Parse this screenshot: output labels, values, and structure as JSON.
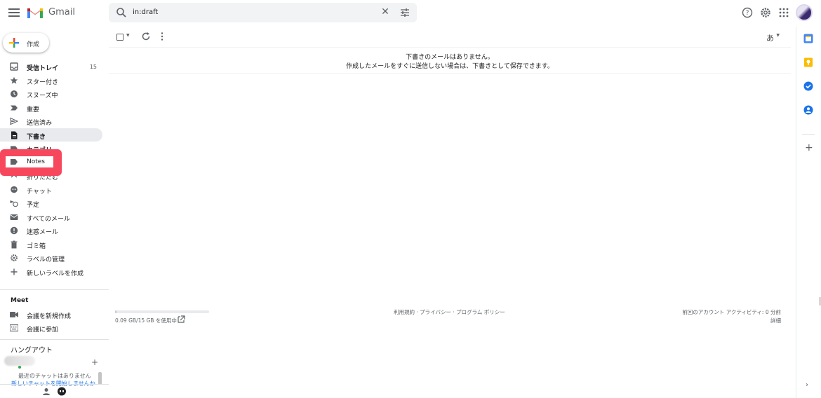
{
  "header": {
    "app_name": "Gmail",
    "search_value": "in:draft"
  },
  "compose": {
    "label": "作成"
  },
  "nav": [
    {
      "name": "inbox",
      "icon": "inbox-icon",
      "label": "受信トレイ",
      "count": "15",
      "bold": true,
      "active": false
    },
    {
      "name": "starred",
      "icon": "star-icon",
      "label": "スター付き",
      "count": "",
      "bold": false,
      "active": false
    },
    {
      "name": "snoozed",
      "icon": "clock-icon",
      "label": "スヌーズ中",
      "count": "",
      "bold": false,
      "active": false
    },
    {
      "name": "important",
      "icon": "important-icon",
      "label": "重要",
      "count": "",
      "bold": false,
      "active": false
    },
    {
      "name": "sent",
      "icon": "send-icon",
      "label": "送信済み",
      "count": "",
      "bold": false,
      "active": false
    },
    {
      "name": "drafts",
      "icon": "draft-icon",
      "label": "下書き",
      "count": "",
      "bold": true,
      "active": true
    },
    {
      "name": "categories",
      "icon": "label-icon",
      "label": "カテゴリ",
      "count": "",
      "bold": true,
      "active": false
    },
    {
      "name": "notes",
      "icon": "label-icon",
      "label": "Notes",
      "count": "",
      "bold": false,
      "active": false
    },
    {
      "name": "less",
      "icon": "chevron-up-icon",
      "label": "折りたたむ",
      "count": "",
      "bold": false,
      "active": false
    },
    {
      "name": "chat",
      "icon": "chat-icon",
      "label": "チャット",
      "count": "",
      "bold": false,
      "active": false
    },
    {
      "name": "scheduled",
      "icon": "scheduled-icon",
      "label": "予定",
      "count": "",
      "bold": false,
      "active": false
    },
    {
      "name": "all-mail",
      "icon": "mail-icon",
      "label": "すべてのメール",
      "count": "",
      "bold": false,
      "active": false
    },
    {
      "name": "spam",
      "icon": "spam-icon",
      "label": "迷惑メール",
      "count": "",
      "bold": false,
      "active": false
    },
    {
      "name": "trash",
      "icon": "trash-icon",
      "label": "ゴミ箱",
      "count": "",
      "bold": false,
      "active": false
    },
    {
      "name": "manage-labels",
      "icon": "gear-icon",
      "label": "ラベルの管理",
      "count": "",
      "bold": false,
      "active": false
    },
    {
      "name": "new-label",
      "icon": "plus-icon",
      "label": "新しいラベルを作成",
      "count": "",
      "bold": false,
      "active": false
    }
  ],
  "highlight": {
    "label": "Notes"
  },
  "meet": {
    "title": "Meet",
    "new_meeting": "会議を新規作成",
    "join_meeting": "会議に参加"
  },
  "hangouts": {
    "title": "ハングアウト",
    "empty_line1": "最近のチャットはありません",
    "empty_line2": "新しいチャットを開始しませんか"
  },
  "toolbar": {
    "ime_label": "あ"
  },
  "empty": {
    "line1": "下書きのメールはありません。",
    "line2": "作成したメールをすぐに送信しない場合は、下書きとして保存できます。"
  },
  "footer": {
    "storage": "0.09 GB/15 GB を使用中",
    "storage_fraction": 0.006,
    "links": "利用規約 · プライバシー · プログラム ポリシー",
    "activity": "前回のアカウント アクティビティ: 0 分前",
    "details": "詳細"
  },
  "colors": {
    "highlight": "#f7475d",
    "active_nav": "#e8eaed"
  }
}
